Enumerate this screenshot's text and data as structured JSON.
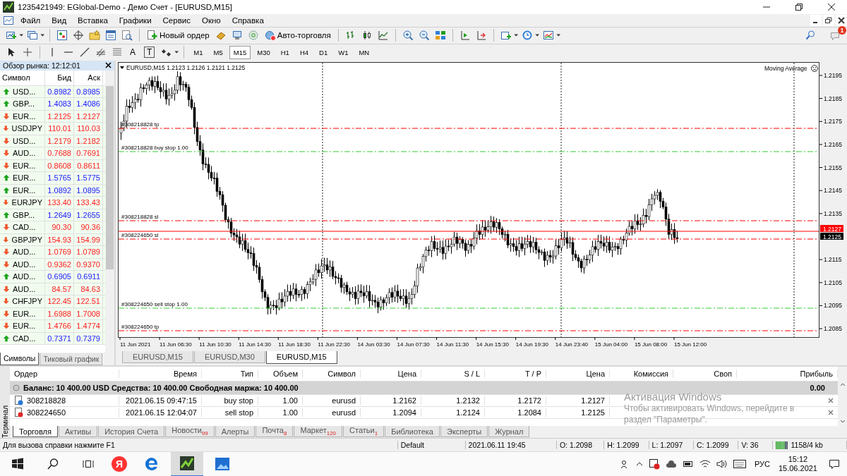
{
  "window": {
    "title": "1235421949: EGlobal-Demo - Демо Счет - [EURUSD,M15]"
  },
  "menu": [
    "Файл",
    "Вид",
    "Вставка",
    "Графики",
    "Сервис",
    "Окно",
    "Справка"
  ],
  "toolbar": {
    "buttons": [
      "Новый ордер",
      "Авто-торговля"
    ],
    "notifications": "1"
  },
  "drawing_tools": [
    "A",
    "T"
  ],
  "timeframes": [
    {
      "label": "M1",
      "selected": false
    },
    {
      "label": "M5",
      "selected": false
    },
    {
      "label": "M15",
      "selected": true
    },
    {
      "label": "M30",
      "selected": false
    },
    {
      "label": "H1",
      "selected": false
    },
    {
      "label": "H4",
      "selected": false
    },
    {
      "label": "D1",
      "selected": false
    },
    {
      "label": "W1",
      "selected": false
    },
    {
      "label": "MN",
      "selected": false
    }
  ],
  "market_watch": {
    "title": "Обзор рынка: 12:12:01",
    "columns": [
      "Символ",
      "Бид",
      "Аск"
    ],
    "rows": [
      {
        "symbol": "USD...",
        "bid": "0.8982",
        "ask": "0.8985",
        "rising": true
      },
      {
        "symbol": "GBP...",
        "bid": "1.4083",
        "ask": "1.4086",
        "rising": true
      },
      {
        "symbol": "EUR...",
        "bid": "1.2125",
        "ask": "1.2127",
        "rising": false
      },
      {
        "symbol": "USDJPY",
        "bid": "110.01",
        "ask": "110.03",
        "rising": false
      },
      {
        "symbol": "USD...",
        "bid": "1.2179",
        "ask": "1.2182",
        "rising": false
      },
      {
        "symbol": "AUD...",
        "bid": "0.7688",
        "ask": "0.7691",
        "rising": false
      },
      {
        "symbol": "EUR...",
        "bid": "0.8608",
        "ask": "0.8611",
        "rising": false
      },
      {
        "symbol": "EUR...",
        "bid": "1.5765",
        "ask": "1.5775",
        "rising": true
      },
      {
        "symbol": "EUR...",
        "bid": "1.0892",
        "ask": "1.0895",
        "rising": true
      },
      {
        "symbol": "EURJPY",
        "bid": "133.40",
        "ask": "133.43",
        "rising": false
      },
      {
        "symbol": "GBP...",
        "bid": "1.2649",
        "ask": "1.2655",
        "rising": true
      },
      {
        "symbol": "CAD...",
        "bid": "90.30",
        "ask": "90.36",
        "rising": false
      },
      {
        "symbol": "GBPJPY",
        "bid": "154.93",
        "ask": "154.99",
        "rising": false
      },
      {
        "symbol": "AUD...",
        "bid": "1.0769",
        "ask": "1.0789",
        "rising": false
      },
      {
        "symbol": "AUD...",
        "bid": "0.9362",
        "ask": "0.9370",
        "rising": false
      },
      {
        "symbol": "AUD...",
        "bid": "0.6905",
        "ask": "0.6911",
        "rising": true
      },
      {
        "symbol": "AUD...",
        "bid": "84.57",
        "ask": "84.63",
        "rising": false
      },
      {
        "symbol": "CHFJPY",
        "bid": "122.45",
        "ask": "122.51",
        "rising": false
      },
      {
        "symbol": "EUR...",
        "bid": "1.6988",
        "ask": "1.7008",
        "rising": false
      },
      {
        "symbol": "EUR...",
        "bid": "1.4766",
        "ask": "1.4774",
        "rising": false
      },
      {
        "symbol": "CAD...",
        "bid": "0.7371",
        "ask": "0.7379",
        "rising": true
      }
    ],
    "tabs": [
      {
        "label": "Символы",
        "selected": true
      },
      {
        "label": "Тиковый график",
        "selected": false
      }
    ]
  },
  "chart": {
    "info": "EURUSD,M15  1.2123 1.2126 1.2121 1.2125",
    "indicator": "Moving Average",
    "order_lines": [
      {
        "label": "#308218828 tp",
        "kind": "tp"
      },
      {
        "label": "#308218828 buy stop 1.00",
        "kind": "entry"
      },
      {
        "label": "#308218828 sl",
        "kind": "sl"
      },
      {
        "label": "#308224650 sl",
        "kind": "sl"
      },
      {
        "label": "#308224650 sell stop 1.00",
        "kind": "entry"
      },
      {
        "label": "#308224650 tp",
        "kind": "tp"
      }
    ],
    "price_axis": [
      "1.2195",
      "1.2185",
      "1.2175",
      "1.2165",
      "1.2155",
      "1.2145",
      "1.2135",
      "1.2115",
      "1.2105",
      "1.2095",
      "1.2085"
    ],
    "price_tags": [
      {
        "text": "1.2127",
        "kind": "ask"
      },
      {
        "text": "1.2125",
        "kind": "bid"
      }
    ],
    "time_axis": [
      "11 Jun 2021",
      "11 Jun 06:30",
      "11 Jun 10:30",
      "11 Jun 14:30",
      "11 Jun 18:30",
      "11 Jun 22:30",
      "14 Jun 03:30",
      "14 Jun 07:30",
      "14 Jun 11:30",
      "14 Jun 15:30",
      "14 Jun 19:30",
      "14 Jun 23:40",
      "15 Jun 04:00",
      "15 Jun 08:00",
      "15 Jun 12:00"
    ],
    "tabs": [
      {
        "label": "EURUSD,M15",
        "selected": false
      },
      {
        "label": "EURUSD,M30",
        "selected": false
      },
      {
        "label": "EURUSD,M15",
        "selected": true
      }
    ]
  },
  "terminal": {
    "label": "Терминал",
    "columns": [
      "Ордер",
      "Время",
      "Тип",
      "Объем",
      "Символ",
      "Цена",
      "S / L",
      "T / P",
      "Цена",
      "Комиссия",
      "Своп",
      "Прибыль"
    ],
    "balance": "Баланс: 10 400.00 USD  Средства: 10 400.00  Свободная маржа: 10 400.00",
    "profit": "0.00",
    "orders": [
      {
        "kind": "buy",
        "cells": [
          "308218828",
          "2021.06.15 09:47:15",
          "buy stop",
          "1.00",
          "eurusd",
          "1.2162",
          "1.2132",
          "1.2172",
          "1.2127"
        ]
      },
      {
        "kind": "sell",
        "cells": [
          "308224650",
          "2021.06.15 12:04:07",
          "sell stop",
          "1.00",
          "eurusd",
          "1.2094",
          "1.2124",
          "1.2084",
          "1.2125"
        ]
      }
    ],
    "tabs": [
      {
        "label": "Торговля",
        "selected": true
      },
      {
        "label": "Активы",
        "selected": false
      },
      {
        "label": "История Счета",
        "selected": false
      },
      {
        "label": "Новости",
        "badge": "99",
        "selected": false
      },
      {
        "label": "Алерты",
        "selected": false
      },
      {
        "label": "Почта",
        "badge": "8",
        "selected": false
      },
      {
        "label": "Маркет",
        "badge": "120",
        "selected": false
      },
      {
        "label": "Статьи",
        "badge": "1",
        "selected": false
      },
      {
        "label": "Библиотека",
        "selected": false
      },
      {
        "label": "Эксперты",
        "selected": false
      },
      {
        "label": "Журнал",
        "selected": false
      }
    ]
  },
  "activation_notice": {
    "title": "Активация Windows",
    "text": "Чтобы активировать Windows, перейдите в раздел \"Параметры\"."
  },
  "status_bar": [
    "Для вызова справки нажмите F1",
    "Default",
    "2021.06.11 19:45",
    "O: 1.2098",
    "H: 1.2099",
    "L: 1.2097",
    "C: 1.2099",
    "V: 36",
    "1158/4 kb"
  ],
  "taskbar": {
    "browser": "Я",
    "language": "РУС",
    "time": "15:12",
    "date": "15.06.2021"
  }
}
